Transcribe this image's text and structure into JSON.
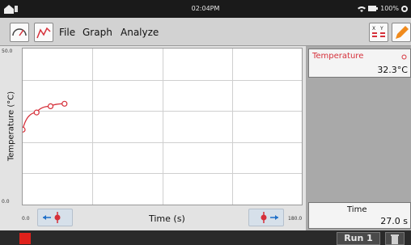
{
  "status_bar": {
    "time": "02:04PM",
    "battery": "100%"
  },
  "menu": {
    "file": "File",
    "graph": "Graph",
    "analyze": "Analyze"
  },
  "graph": {
    "y_max": "50.0",
    "y_min": "0.0",
    "y_label": "Temperature (°C)",
    "x_min": "0.0",
    "x_max": "180.0",
    "x_label": "Time (s)",
    "line_color": "#d6303a"
  },
  "chart_data": {
    "type": "line",
    "xlim": [
      0,
      180
    ],
    "ylim": [
      0,
      50
    ],
    "xlabel": "Time (s)",
    "ylabel": "Temperature (°C)",
    "grid": true,
    "series": [
      {
        "name": "Temperature",
        "x": [
          0,
          9,
          18,
          27
        ],
        "y": [
          24.0,
          29.5,
          31.5,
          32.3
        ]
      }
    ]
  },
  "meters": {
    "temperature": {
      "label": "Temperature",
      "value": "32.3°C",
      "color": "#d6303a"
    },
    "time": {
      "label": "Time",
      "value": "27.0 s"
    }
  },
  "bottom": {
    "run_label": "Run 1"
  },
  "colors": {
    "stop": "#e0211b",
    "accent_orange": "#f08a1c",
    "series_red": "#d6303a"
  }
}
